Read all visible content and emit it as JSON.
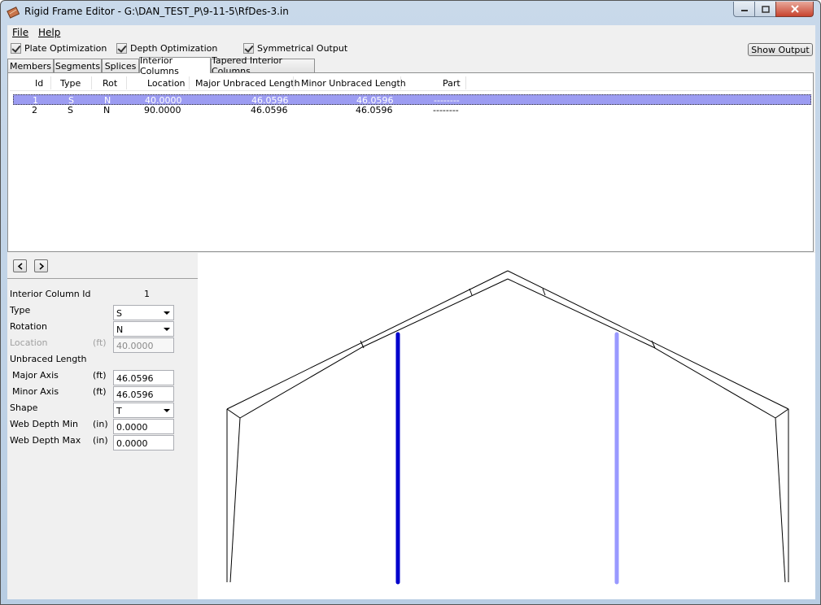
{
  "window": {
    "title": "Rigid Frame Editor - G:\\DAN_TEST_P\\9-11-5\\RfDes-3.in"
  },
  "menu": {
    "file": "File",
    "help": "Help"
  },
  "options": {
    "plate_optimization": "Plate Optimization",
    "depth_optimization": "Depth Optimization",
    "symmetrical_output": "Symmetrical Output",
    "show_output": "Show Output"
  },
  "tabs": [
    {
      "label": "Members"
    },
    {
      "label": "Segments"
    },
    {
      "label": "Splices"
    },
    {
      "label": "Interior Columns"
    },
    {
      "label": "Tapered Interior Columns"
    }
  ],
  "list": {
    "columns": [
      "Id",
      "Type",
      "Rot",
      "Location",
      "Major Unbraced Length",
      "Minor Unbraced Length",
      "Part"
    ],
    "rows": [
      {
        "id": "1",
        "type": "S",
        "rot": "N",
        "location": "40.0000",
        "major": "46.0596",
        "minor": "46.0596",
        "part": "--------"
      },
      {
        "id": "2",
        "type": "S",
        "rot": "N",
        "location": "90.0000",
        "major": "46.0596",
        "minor": "46.0596",
        "part": "--------"
      }
    ]
  },
  "nav": {
    "prev": "<",
    "next": ">"
  },
  "form": {
    "interior_column_id_label": "Interior Column Id",
    "interior_column_id_value": "1",
    "type_label": "Type",
    "type_value": "S",
    "rotation_label": "Rotation",
    "rotation_value": "N",
    "location_label": "Location",
    "location_unit": "(ft)",
    "location_value": "40.0000",
    "unbraced_length_label": "Unbraced Length",
    "major_axis_label": "Major Axis",
    "major_axis_unit": "(ft)",
    "major_axis_value": "46.0596",
    "minor_axis_label": "Minor Axis",
    "minor_axis_unit": "(ft)",
    "minor_axis_value": "46.0596",
    "shape_label": "Shape",
    "shape_value": "T",
    "web_depth_min_label": "Web Depth Min",
    "web_depth_min_unit": "(in)",
    "web_depth_min_value": "0.0000",
    "web_depth_max_label": "Web Depth Max",
    "web_depth_max_unit": "(in)",
    "web_depth_max_value": "0.0000"
  },
  "colors": {
    "selected_column": "#0000cc",
    "other_column": "#9999ff",
    "selection_row": "#9c9cf2"
  }
}
